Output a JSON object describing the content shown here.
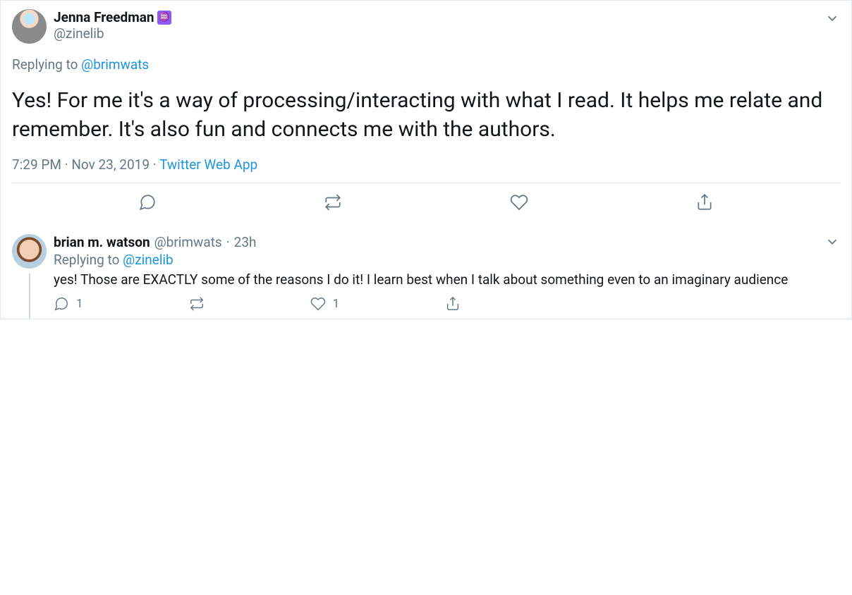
{
  "main_tweet": {
    "author": {
      "display_name": "Jenna Freedman",
      "handle": "@zinelib",
      "emoji": "♒"
    },
    "replying_to_label": "Replying to ",
    "replying_to_handle": "@brimwats",
    "text": "Yes! For me it's a way of processing/interacting with what I read. It helps me relate and remember. It's also fun and connects me with the authors.",
    "time": "7:29 PM",
    "date": "Nov 23, 2019",
    "source": "Twitter Web App",
    "sep": " · "
  },
  "reply": {
    "author": {
      "display_name": "brian m. watson",
      "handle": "@brimwats",
      "time": "23h"
    },
    "replying_to_label": "Replying to ",
    "replying_to_handle": "@zinelib",
    "text": "yes! Those are EXACTLY some of the reasons I do it! I learn best when I talk about something even to an imaginary audience",
    "counts": {
      "replies": "1",
      "likes": "1"
    }
  }
}
